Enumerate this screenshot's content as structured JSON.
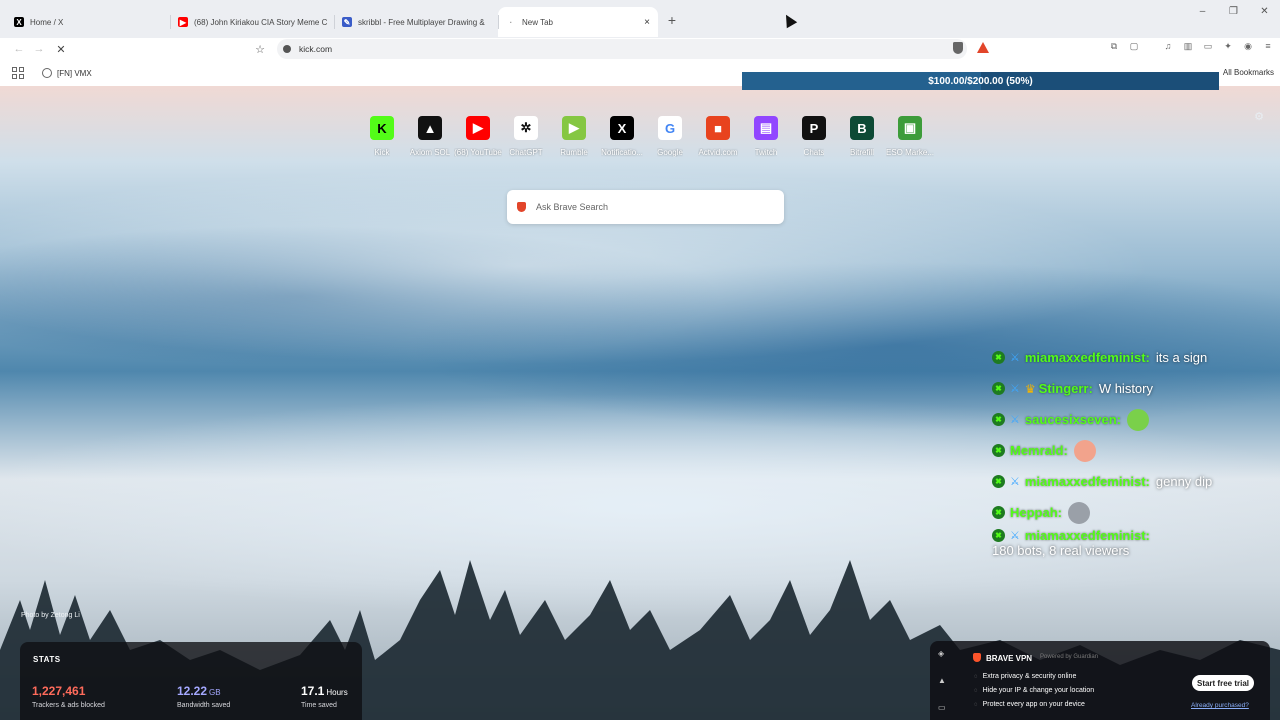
{
  "tabs": [
    {
      "title": "Home / X",
      "icon": "x-logo-icon"
    },
    {
      "title": "(68) John Kiriakou CIA Story Meme C",
      "icon": "youtube-icon"
    },
    {
      "title": "skribbl - Free Multiplayer Drawing &",
      "icon": "skribbl-icon"
    },
    {
      "title": "New Tab",
      "icon": "new-tab-icon",
      "active": true,
      "close": "×"
    }
  ],
  "new_tab_label": "+",
  "window_controls": {
    "minimize": "–",
    "restore": "❐",
    "close": "✕"
  },
  "toolbar": {
    "back": "←",
    "forward": "→",
    "reload": "✕",
    "bookmark": "☆",
    "url": "kick.com"
  },
  "bookmarks": {
    "items": [
      {
        "label": "[FN] VMX"
      }
    ],
    "all_label": "All Bookmarks"
  },
  "donation": {
    "text": "$100.00/$200.00 (50%)",
    "progress": 0.5
  },
  "top_sites": [
    {
      "label": "Kick",
      "glyph": "K",
      "color": "#53fc18",
      "text_color": "#000"
    },
    {
      "label": "Axiom SOL",
      "glyph": "▲",
      "color": "#111111",
      "text_color": "#fff"
    },
    {
      "label": "(68) YouTube",
      "glyph": "▶",
      "color": "#ff0000",
      "text_color": "#fff"
    },
    {
      "label": "ChatGPT",
      "glyph": "✲",
      "color": "#ffffff",
      "text_color": "#111"
    },
    {
      "label": "Rumble",
      "glyph": "▶",
      "color": "#85c742",
      "text_color": "#fff"
    },
    {
      "label": "Notificatio...",
      "glyph": "X",
      "color": "#000000",
      "text_color": "#fff"
    },
    {
      "label": "Google",
      "glyph": "G",
      "color": "#ffffff",
      "text_color": "#4285f4"
    },
    {
      "label": "Actvid.com",
      "glyph": "■",
      "color": "#e8431e",
      "text_color": "#fff"
    },
    {
      "label": "Twitch",
      "glyph": "▤",
      "color": "#9146ff",
      "text_color": "#fff"
    },
    {
      "label": "Chats",
      "glyph": "P",
      "color": "#111111",
      "text_color": "#fff"
    },
    {
      "label": "Bitrefill",
      "glyph": "B",
      "color": "#0d4a35",
      "text_color": "#fff"
    },
    {
      "label": "ESO Marke...",
      "glyph": "▣",
      "color": "#3d9c3a",
      "text_color": "#fff"
    }
  ],
  "search_placeholder": "Ask Brave Search",
  "chat": [
    {
      "badges": [
        "kick",
        "sword"
      ],
      "user": "miamaxxedfeminist:",
      "text": "its a sign"
    },
    {
      "badges": [
        "kick",
        "sword",
        "crown"
      ],
      "user": "Stingerr:",
      "text": "W history"
    },
    {
      "badges": [
        "kick",
        "sword"
      ],
      "user": "saucesixseven:",
      "emote": "#7ad04a"
    },
    {
      "badges": [
        "kick"
      ],
      "user": "Memrald:",
      "emote": "#f2a38c"
    },
    {
      "badges": [
        "kick",
        "sword"
      ],
      "user": "miamaxxedfeminist:",
      "text": "genny dip"
    },
    {
      "badges": [
        "kick"
      ],
      "user": "Heppah:",
      "emote": "#9aa0a8"
    },
    {
      "badges": [
        "kick",
        "sword"
      ],
      "user": "miamaxxedfeminist:",
      "text": "180 bots, 8 real viewers"
    }
  ],
  "photo_credit": "Photo by Zetong Li",
  "stats": {
    "heading": "STATS",
    "items": [
      {
        "value": "1,227,461",
        "unit": "",
        "label": "Trackers & ads blocked",
        "color": "#ff6b5b"
      },
      {
        "value": "12.22",
        "unit": "GB",
        "label": "Bandwidth saved",
        "color": "#a4a8ff"
      },
      {
        "value": "17.1",
        "unit": "Hours",
        "label": "Time saved",
        "color": "#ffffff"
      }
    ]
  },
  "vpn": {
    "title": "BRAVE VPN",
    "powered": "Powered by  Guardian",
    "features": [
      "Extra privacy & security online",
      "Hide your IP & change your location",
      "Protect every app on your device"
    ],
    "cta": "Start free trial",
    "already": "Already purchased?"
  }
}
